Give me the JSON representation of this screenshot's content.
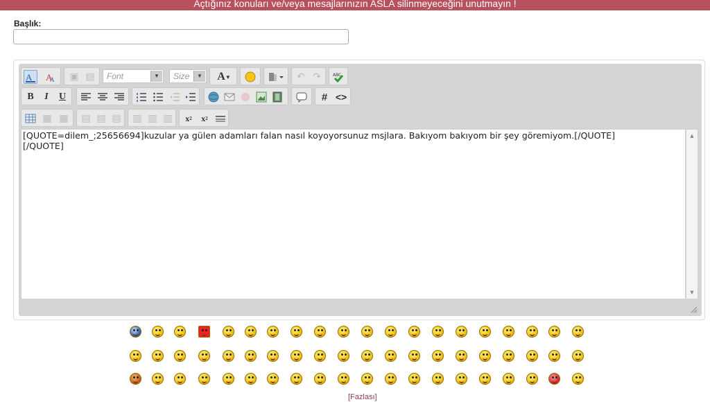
{
  "banner": {
    "text": "Açtığınız konuları ve/veya mesajlarınızın ASLA silinmeyeceğini unutmayın !"
  },
  "form": {
    "title_label": "Başlık:",
    "title_value": ""
  },
  "toolbar": {
    "font_label": "Font",
    "size_label": "Size",
    "bold": "B",
    "italic": "I",
    "underline": "U",
    "hash": "#",
    "code": "<>",
    "font_color": "A"
  },
  "editor": {
    "content": "[QUOTE=dilem_;25656694]kuzular ya gülen adamları falan nasıl koyoyorsunuz msjlara. Bakıyom bakıyom bir şey göremiyom.[/QUOTE]\n[/QUOTE]"
  },
  "smilies": {
    "more_link": "[Fazlası]"
  },
  "colors": {
    "banner": "#b8505e",
    "link": "#8a3a4a",
    "editor_bg": "#d4d4d4"
  }
}
